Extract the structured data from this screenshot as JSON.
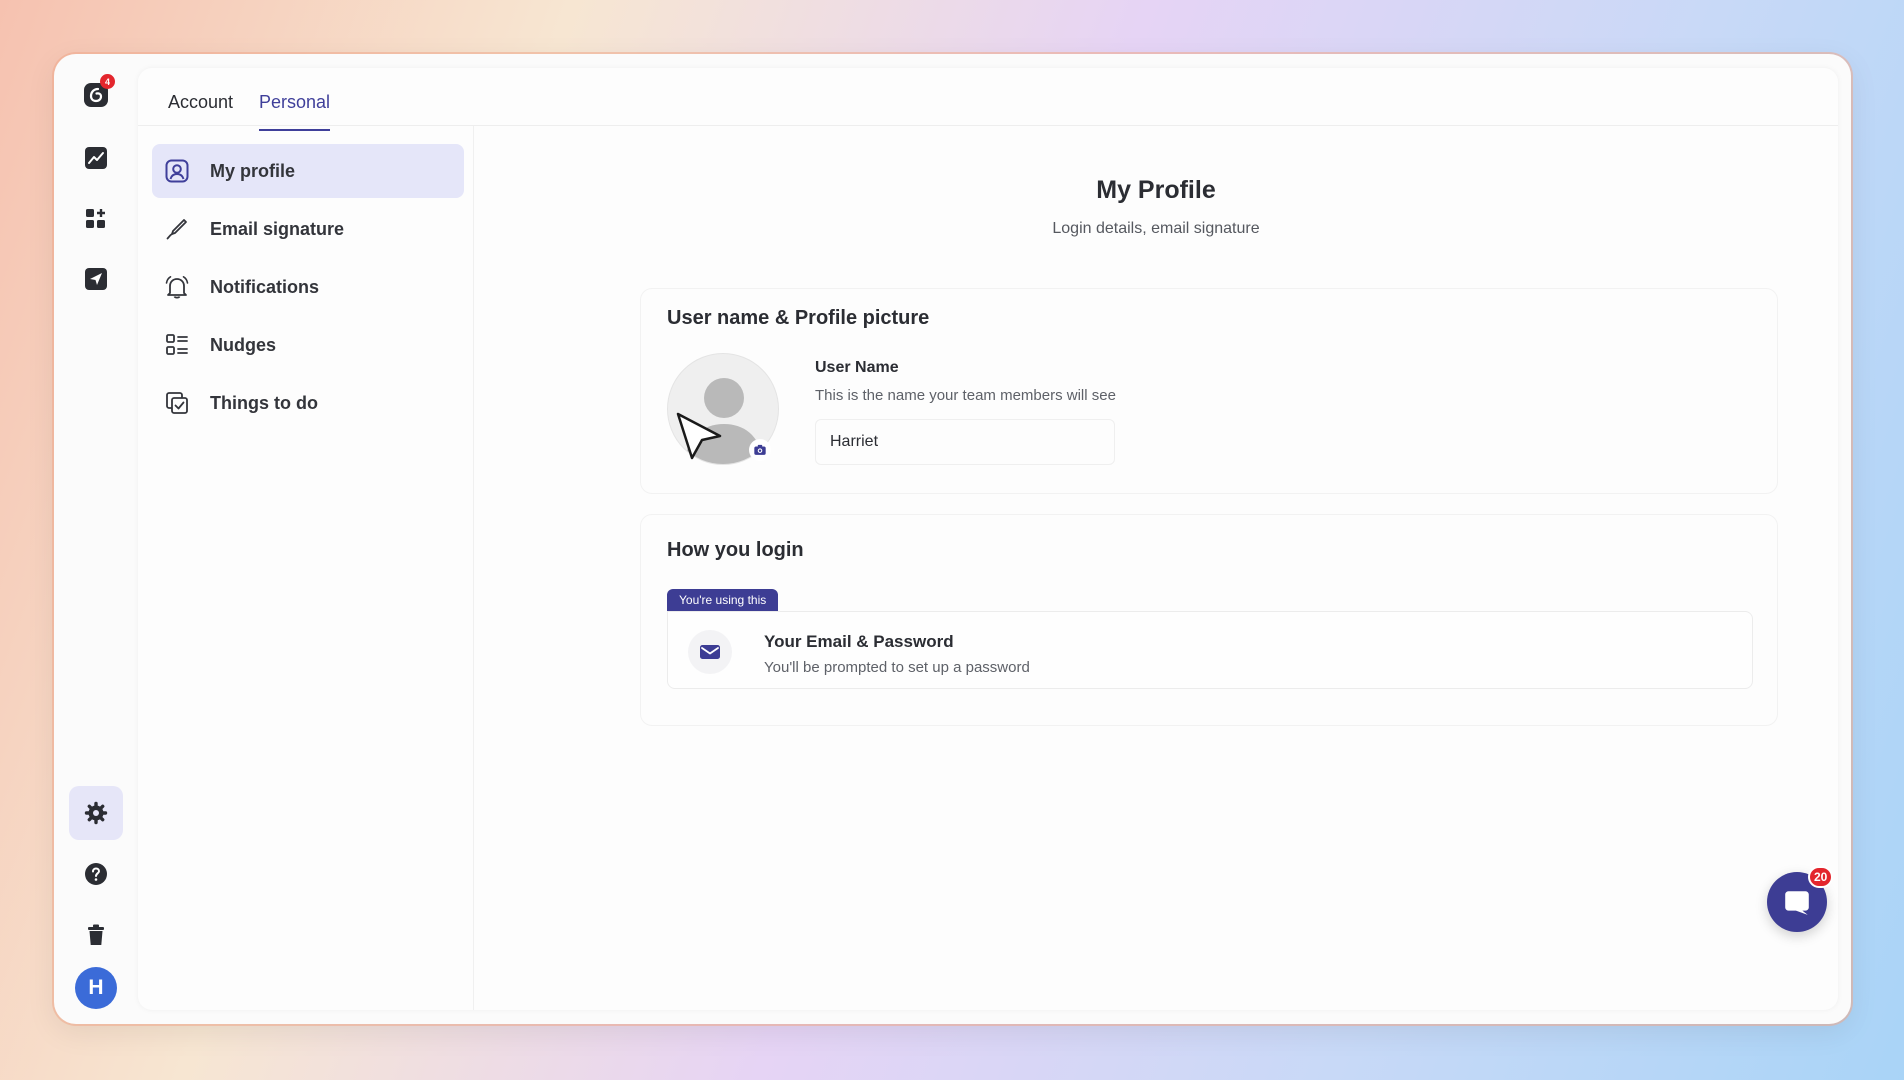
{
  "rail": {
    "logo_badge_count": "4",
    "avatar_initial": "H"
  },
  "tabs": [
    {
      "label": "Account"
    },
    {
      "label": "Personal"
    }
  ],
  "settings_nav": [
    {
      "label": "My profile",
      "icon": "user-profile-icon"
    },
    {
      "label": "Email signature",
      "icon": "pen-icon"
    },
    {
      "label": "Notifications",
      "icon": "bell-icon"
    },
    {
      "label": "Nudges",
      "icon": "list-icon"
    },
    {
      "label": "Things to do",
      "icon": "checklist-icon"
    }
  ],
  "page": {
    "title": "My Profile",
    "subtitle": "Login details, email signature"
  },
  "profile_card": {
    "title": "User name & Profile picture",
    "field_label": "User Name",
    "field_help": "This is the name your team members will see",
    "username_value": "Harriet"
  },
  "login_card": {
    "title": "How you login",
    "badge": "You're using this",
    "option_title": "Your Email & Password",
    "option_sub": "You'll be prompted to set up a password"
  },
  "chat": {
    "badge_count": "20"
  },
  "colors": {
    "accent": "#3d3d94",
    "badge_red": "#e3262d",
    "active_bg": "#e5e6f9",
    "avatar_blue": "#3b6bd8"
  }
}
